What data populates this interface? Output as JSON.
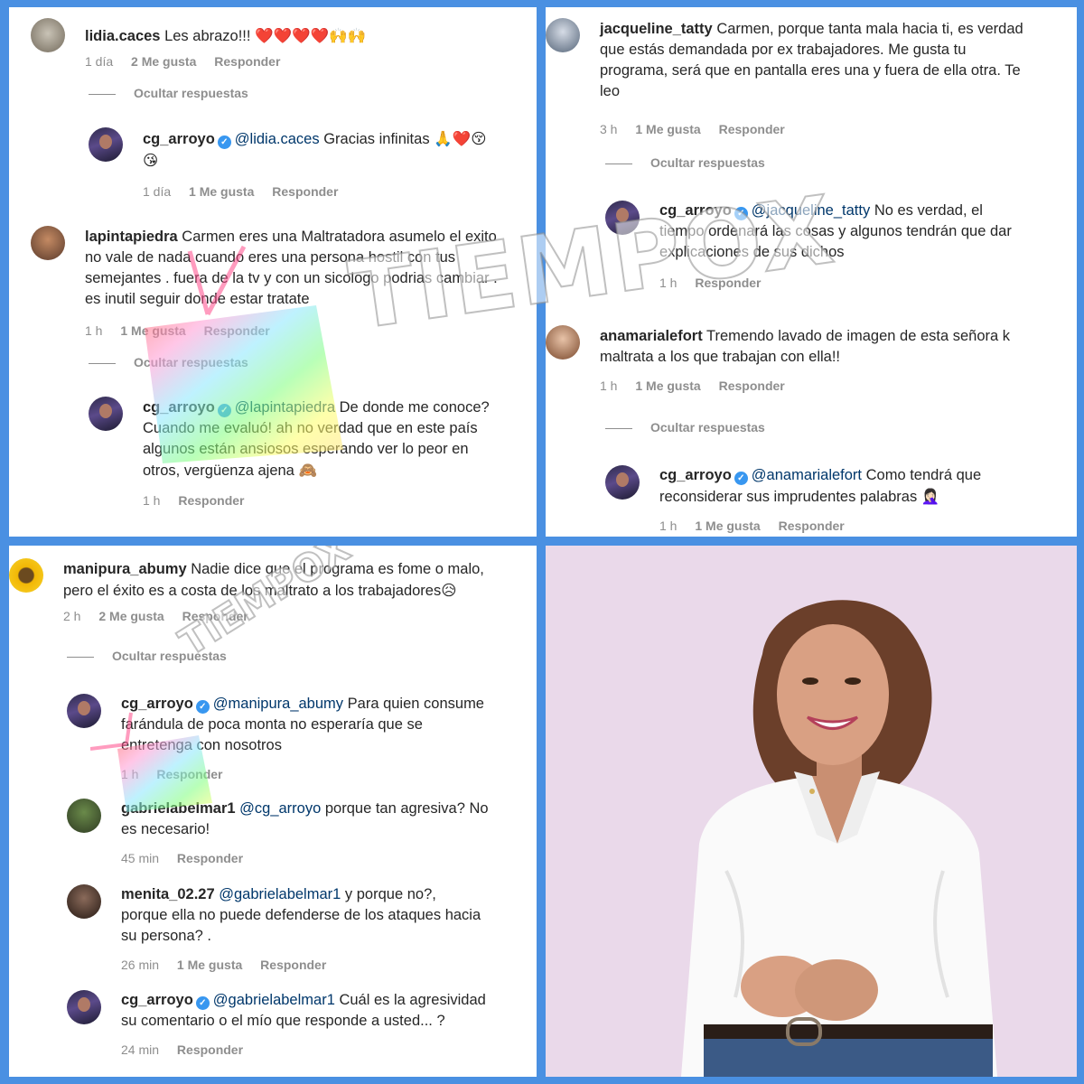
{
  "watermark": "TIEMPOX",
  "panel1": {
    "c1": {
      "user": "lidia.caces",
      "text": "Les abrazo!!!",
      "emoji": "❤️❤️❤️❤️🙌🙌",
      "time": "1 día",
      "likes": "2 Me gusta",
      "reply": "Responder"
    },
    "hide1": "Ocultar respuestas",
    "r1": {
      "user": "cg_arroyo",
      "mention": "@lidia.caces",
      "text": "Gracias infinitas",
      "emoji": "🙏❤️😚",
      "emoji2": "😘",
      "time": "1 día",
      "likes": "1 Me gusta",
      "reply": "Responder"
    },
    "c2": {
      "user": "lapintapiedra",
      "text1": "Carmen eres una Maltratadora asumelo el exito",
      "text2": "no vale de nada cuando eres una persona hostil con tus",
      "text3": "semejantes . fuera de la tv y con un sicologo podrias cambiar .",
      "text4": "es inutil seguir donde estar tratate",
      "time": "1 h",
      "likes": "1 Me gusta",
      "reply": "Responder"
    },
    "hide2": "Ocultar respuestas",
    "r2": {
      "user": "cg_arroyo",
      "mention": "@lapintapiedra",
      "text1": "De donde me conoce?",
      "text2": "Cuando me evaluó! ah no verdad que en este país",
      "text3": "algunos están ansiosos esperando ver lo peor en",
      "text4": "otros, vergüenza ajena",
      "emoji": "🙈",
      "time": "1 h",
      "reply": "Responder"
    }
  },
  "panel2": {
    "c1": {
      "user": "jacqueline_tatty",
      "text1": "Carmen, porque tanta mala hacia ti, es verdad",
      "text2": "que estás demandada por ex trabajadores. Me gusta tu",
      "text3": "programa, será que en pantalla eres una y fuera de ella otra. Te",
      "text4": "leo",
      "time": "3 h",
      "likes": "1 Me gusta",
      "reply": "Responder"
    },
    "hide1": "Ocultar respuestas",
    "r1": {
      "user": "cg_arroyo",
      "mention": "@jacqueline_tatty",
      "text1": "No es verdad, el",
      "text2": "tiempo ordenará las cosas y algunos tendrán que dar",
      "text3": "explicaciones de sus dichos",
      "time": "1 h",
      "reply": "Responder"
    },
    "c2": {
      "user": "anamarialefort",
      "text1": "Tremendo lavado de imagen de esta señora k",
      "text2": "maltrata a los que trabajan con ella!!",
      "time": "1 h",
      "likes": "1 Me gusta",
      "reply": "Responder"
    },
    "hide2": "Ocultar respuestas",
    "r2": {
      "user": "cg_arroyo",
      "mention": "@anamarialefort",
      "text1": "Como tendrá que",
      "text2": "reconsiderar sus imprudentes palabras",
      "emoji": "🤦🏻‍♀️",
      "time": "1 h",
      "likes": "1 Me gusta",
      "reply": "Responder"
    }
  },
  "panel3": {
    "c1": {
      "user": "manipura_abumy",
      "text1": "Nadie dice que el programa es fome o malo,",
      "text2": "pero el éxito es a costa de los maltrato a los trabajadores",
      "emoji": "😥",
      "time": "2 h",
      "likes": "2 Me gusta",
      "reply": "Responder"
    },
    "hide1": "Ocultar respuestas",
    "r1": {
      "user": "cg_arroyo",
      "mention": "@manipura_abumy",
      "text1": "Para quien consume",
      "text2": "farándula de poca monta no esperaría que se",
      "text3": "entretenga con nosotros",
      "time": "1 h",
      "reply": "Responder"
    },
    "r2": {
      "user": "gabrielabelmar1",
      "mention": "@cg_arroyo",
      "text1": "porque tan agresiva? No",
      "text2": "es necesario!",
      "time": "45 min",
      "reply": "Responder"
    },
    "r3": {
      "user": "menita_02.27",
      "mention": "@gabrielabelmar1",
      "text1": "y porque no?,",
      "text2": "porque ella no puede defenderse de los ataques hacia",
      "text3": "su persona? .",
      "time": "26 min",
      "likes": "1 Me gusta",
      "reply": "Responder"
    },
    "r4": {
      "user": "cg_arroyo",
      "mention": "@gabrielabelmar1",
      "text1": "Cuál es la agresividad",
      "text2": "su comentario o el mío que responde a usted... ?",
      "time": "24 min",
      "reply": "Responder"
    }
  },
  "colors": {
    "frame": "#4a90e2",
    "verified": "#3897f0",
    "mention": "#00376b",
    "meta": "#8e8e8e",
    "photo_bg": "#ead9ea"
  }
}
